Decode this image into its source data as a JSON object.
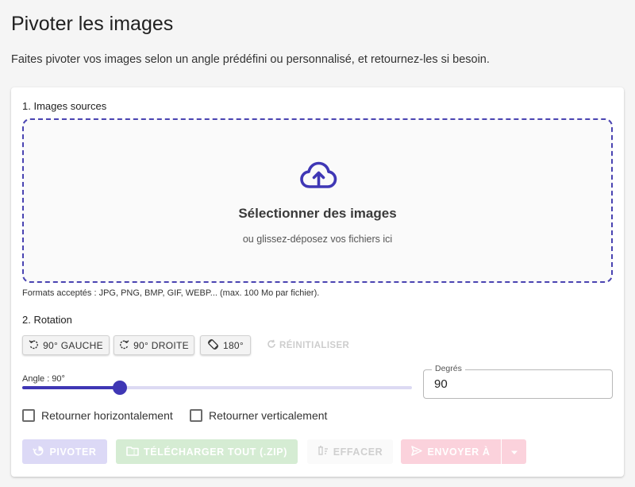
{
  "page": {
    "title": "Pivoter les images",
    "subtitle": "Faites pivoter vos images selon un angle prédéfini ou personnalisé, et retournez-les si besoin."
  },
  "sources": {
    "label": "1. Images sources",
    "dropzone_title": "Sélectionner des images",
    "dropzone_subtitle": "ou glissez-déposez vos fichiers ici",
    "formats_note": "Formats acceptés : JPG, PNG, BMP, GIF, WEBP... (max. 100 Mo par fichier).",
    "icon": "cloud-upload-icon"
  },
  "rotation": {
    "label": "2. Rotation",
    "preset_buttons": [
      {
        "label": "90° GAUCHE",
        "icon": "rotate-left-icon"
      },
      {
        "label": "90° DROITE",
        "icon": "rotate-right-icon"
      },
      {
        "label": "180°",
        "icon": "screen-rotation-icon"
      }
    ],
    "reset_label": "RÉINITIALISER",
    "angle_label": "Angle : 90°",
    "angle_value": 90,
    "angle_min": 0,
    "angle_max": 360,
    "degrees_legend": "Degrés",
    "degrees_value": "90",
    "flip_horizontal_label": "Retourner horizontalement",
    "flip_vertical_label": "Retourner verticalement"
  },
  "actions": {
    "pivot_label": "PIVOTER",
    "download_all_label": "TÉLÉCHARGER TOUT (.ZIP)",
    "clear_label": "EFFACER",
    "send_label": "ENVOYER À"
  },
  "colors": {
    "accent": "#3f37b5",
    "dropzone_border": "#4a44b2",
    "pivot_disabled": "#dcd9f6",
    "download_disabled": "#d5ecd3",
    "send_disabled": "#fbd2dc"
  }
}
